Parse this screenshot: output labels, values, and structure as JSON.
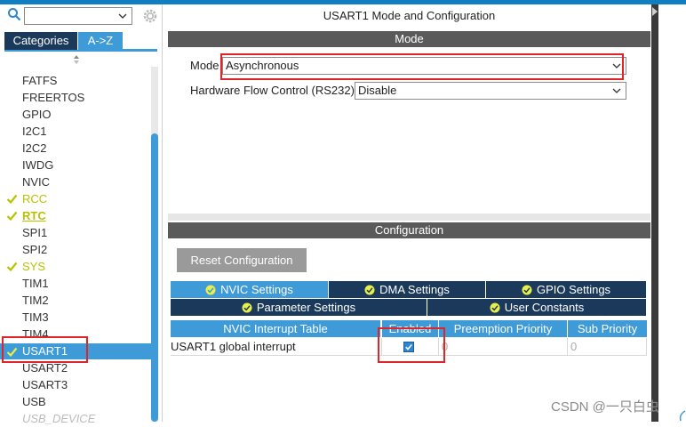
{
  "left_panel": {
    "search": {
      "value": ""
    },
    "tabs": [
      {
        "label": "Categories"
      },
      {
        "label": "A->Z"
      }
    ],
    "items": [
      {
        "label": "FATFS",
        "status": ""
      },
      {
        "label": "FREERTOS",
        "status": ""
      },
      {
        "label": "GPIO",
        "status": ""
      },
      {
        "label": "I2C1",
        "status": ""
      },
      {
        "label": "I2C2",
        "status": ""
      },
      {
        "label": "IWDG",
        "status": ""
      },
      {
        "label": "NVIC",
        "status": ""
      },
      {
        "label": "RCC",
        "status": "configured"
      },
      {
        "label": "RTC",
        "status": "configured"
      },
      {
        "label": "SPI1",
        "status": ""
      },
      {
        "label": "SPI2",
        "status": ""
      },
      {
        "label": "SYS",
        "status": "configured"
      },
      {
        "label": "TIM1",
        "status": ""
      },
      {
        "label": "TIM2",
        "status": ""
      },
      {
        "label": "TIM3",
        "status": ""
      },
      {
        "label": "TIM4",
        "status": ""
      },
      {
        "label": "USART1",
        "status": "selected"
      },
      {
        "label": "USART2",
        "status": ""
      },
      {
        "label": "USART3",
        "status": ""
      },
      {
        "label": "USB",
        "status": ""
      },
      {
        "label": "USB_DEVICE",
        "status": "disabled"
      }
    ]
  },
  "main": {
    "title": "USART1 Mode and Configuration",
    "mode_section": {
      "header": "Mode",
      "mode_label": "Mode",
      "mode_value": "Asynchronous",
      "hwflow_label": "Hardware Flow Control (RS232)",
      "hwflow_value": "Disable"
    },
    "config_section": {
      "header": "Configuration",
      "reset_button": "Reset Configuration",
      "tabs_row1": [
        "NVIC Settings",
        "DMA Settings",
        "GPIO Settings"
      ],
      "tabs_row2": [
        "Parameter Settings",
        "User Constants"
      ],
      "table": {
        "headers": [
          "NVIC Interrupt Table",
          "Enabled",
          "Preemption Priority",
          "Sub Priority"
        ],
        "rows": [
          {
            "name": "USART1 global interrupt",
            "enabled": true,
            "preemption": "0",
            "sub": "0"
          }
        ]
      }
    }
  },
  "watermark": "CSDN @一只白虫",
  "colors": {
    "accent_blue": "#3f9ad8",
    "dark_navy": "#1b3a5b",
    "section_gray": "#5a5a5a",
    "configured_yellow": "#b8c200",
    "highlight_red": "#e0252a"
  }
}
